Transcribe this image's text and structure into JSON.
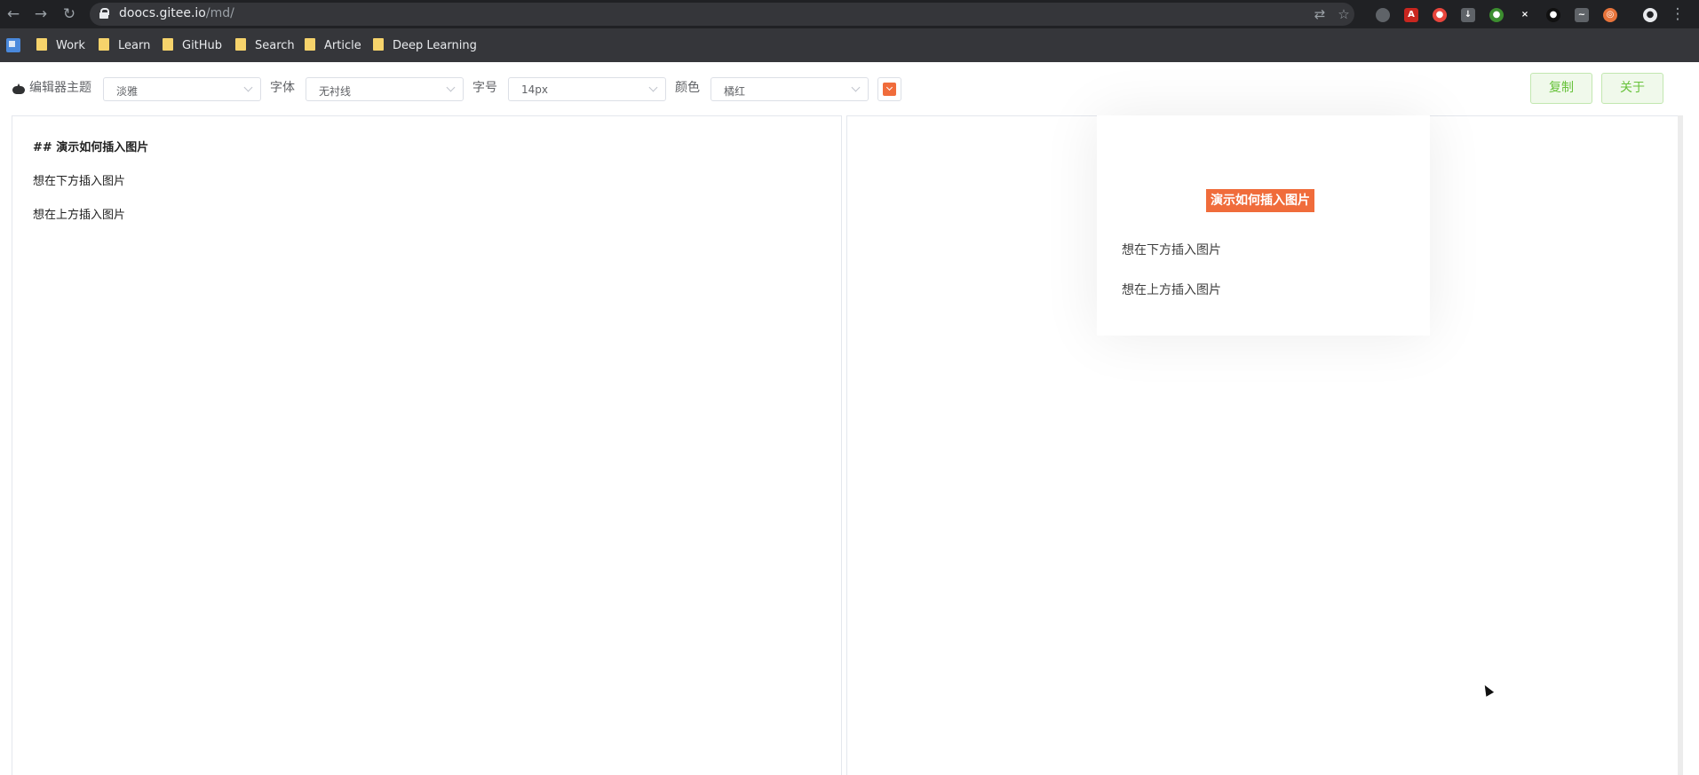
{
  "browser": {
    "url_host": "doocs.gitee.io",
    "url_path": "/md/",
    "bookmarks": [
      "Work",
      "Learn",
      "GitHub",
      "Search",
      "Article",
      "Deep Learning"
    ]
  },
  "toolbar": {
    "theme_label": "编辑器主题",
    "theme_value": "淡雅",
    "font_label": "字体",
    "font_value": "无衬线",
    "size_label": "字号",
    "size_value": "14px",
    "color_label": "颜色",
    "color_value": "橘红",
    "accent_color": "#f06c3b",
    "copy_label": "复制",
    "about_label": "关于"
  },
  "editor": {
    "lines": [
      "## 演示如何插入图片",
      "想在下方插入图片",
      "想在上方插入图片"
    ]
  },
  "preview": {
    "title": "演示如何插入图片",
    "paragraphs": [
      "想在下方插入图片",
      "想在上方插入图片"
    ]
  },
  "colors": {
    "button_text": "#67c23a",
    "button_bg": "#f0f9eb",
    "chrome_dark": "#202124"
  }
}
